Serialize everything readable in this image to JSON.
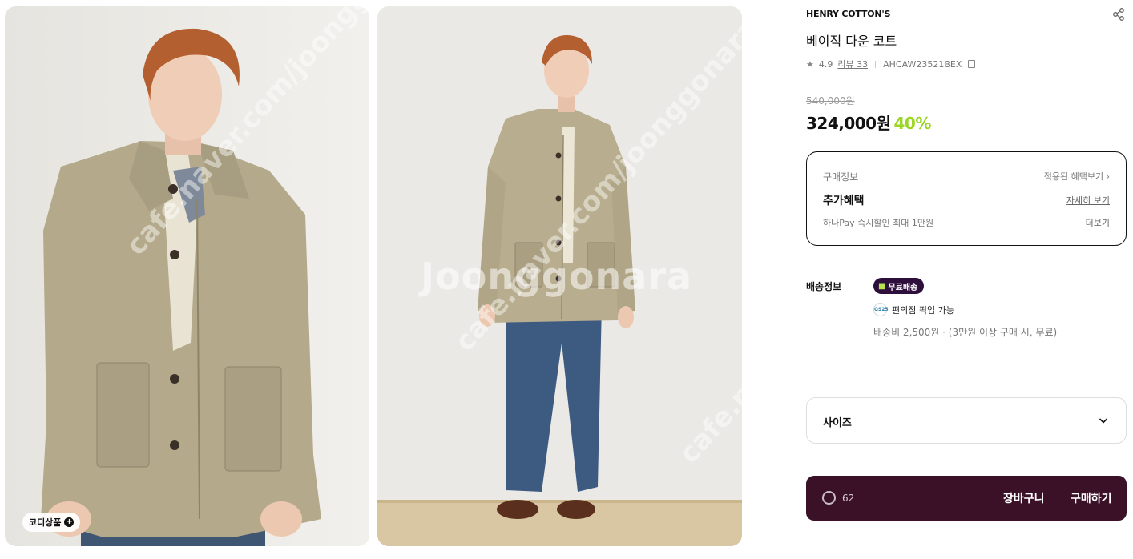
{
  "gallery": {
    "codi_label": "코디상품",
    "watermark_main": "Joonggonara",
    "watermark_diag": "cafe.naver.com/joonggonara"
  },
  "product": {
    "brand": "HENRY COTTON'S",
    "name": "베이직 다운 코트",
    "rating": "4.9",
    "review_label": "리뷰 33",
    "code": "AHCAW23521BEX",
    "original_price": "540,000원",
    "sale_price": "324,000원",
    "discount": "40%"
  },
  "benefits": {
    "title": "구매정보",
    "applied_link": "적용된 혜택보기 ›",
    "extra_title": "추가혜택",
    "detail_link": "자세히 보기",
    "pay_text": "하나Pay 즉시할인 최대 1만원",
    "more_link": "더보기"
  },
  "shipping": {
    "label": "배송정보",
    "free_badge": "무료배송",
    "cvs_logo": "GS25",
    "cvs_text": "편의점 픽업 가능",
    "fee_text": "배송비 2,500원 · (3만원 이상 구매 시, 무료)"
  },
  "size": {
    "label": "사이즈"
  },
  "actions": {
    "like_count": "62",
    "cart_label": "장바구니",
    "buy_label": "구매하기"
  },
  "colors": {
    "accent_green": "#9ad623",
    "bar_bg": "#3b1127",
    "badge_bg": "#2e0f3b"
  }
}
